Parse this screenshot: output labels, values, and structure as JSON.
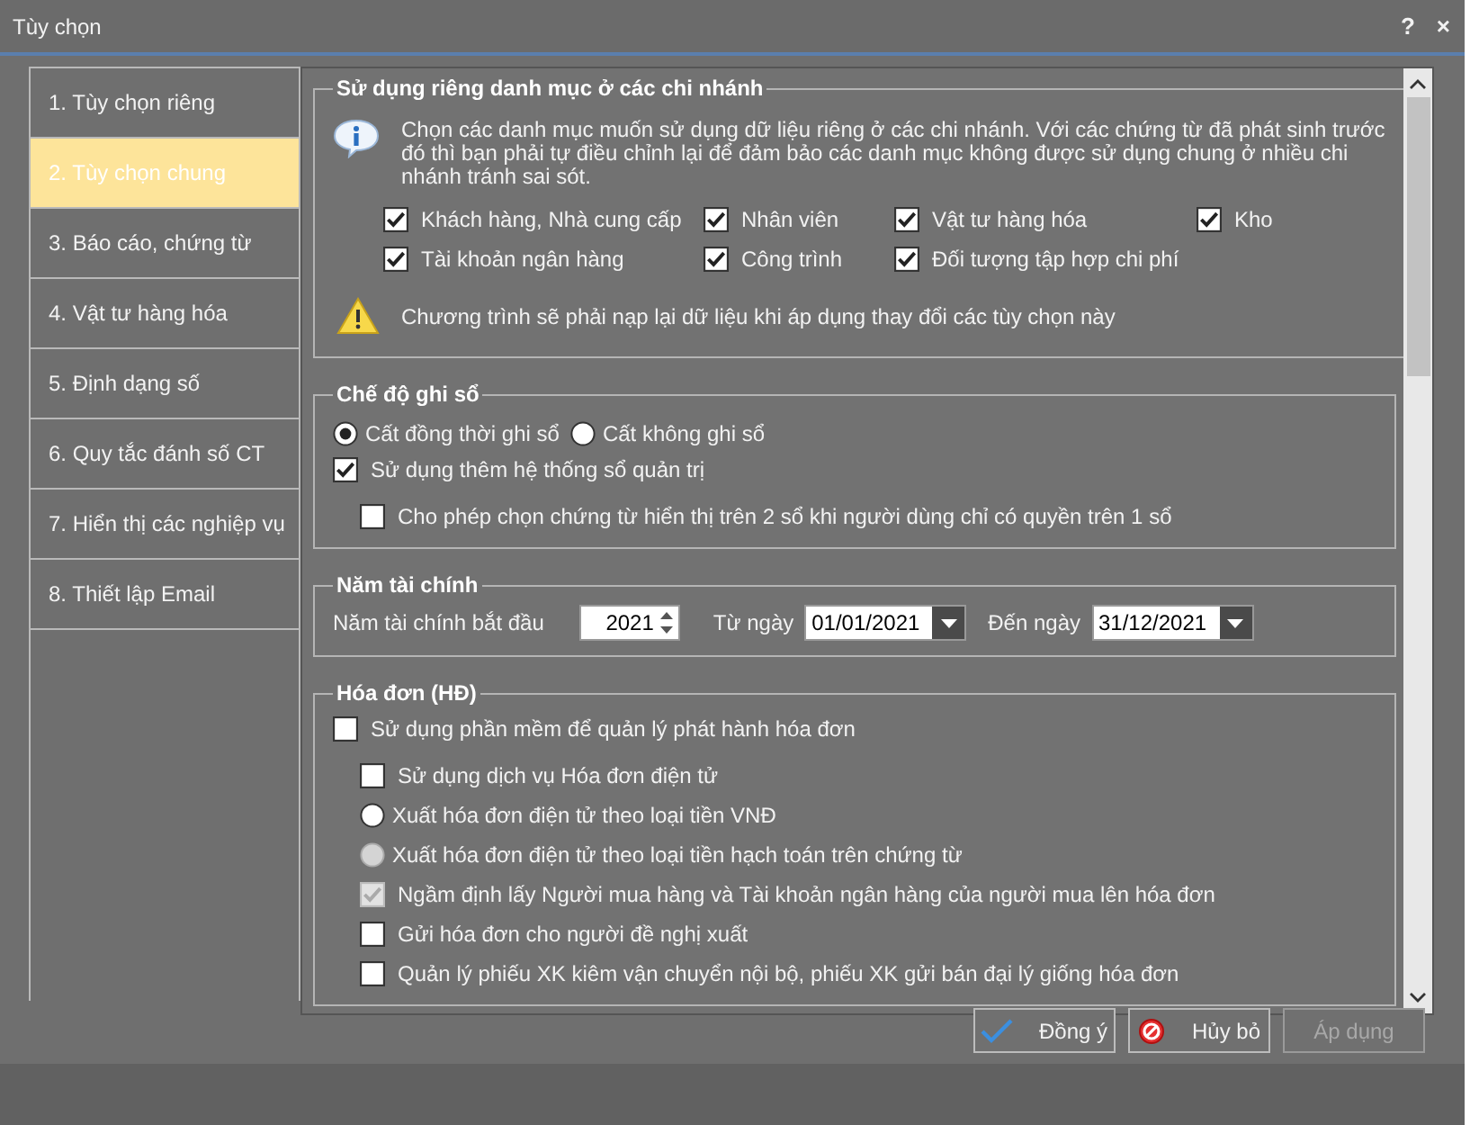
{
  "window": {
    "title": "Tùy chọn",
    "help": "?",
    "close": "×"
  },
  "sidebar": {
    "items": [
      {
        "label": "1. Tùy chọn riêng",
        "selected": false
      },
      {
        "label": "2. Tùy chọn chung",
        "selected": true
      },
      {
        "label": "3. Báo cáo, chứng từ",
        "selected": false
      },
      {
        "label": "4. Vật tư hàng hóa",
        "selected": false
      },
      {
        "label": "5. Định dạng số",
        "selected": false
      },
      {
        "label": "6. Quy tắc đánh số CT",
        "selected": false
      },
      {
        "label": "7. Hiển thị các nghiệp vụ",
        "selected": false
      },
      {
        "label": "8. Thiết lập Email",
        "selected": false
      }
    ]
  },
  "branch_section": {
    "title": "Sử dụng riêng danh mục ở các chi nhánh",
    "info": "Chọn các danh mục muốn sử dụng dữ liệu riêng ở các chi nhánh. Với các chứng từ đã phát sinh trước đó thì bạn phải tự điều chỉnh lại để đảm bảo các danh mục không được sử dụng chung ở nhiều chi nhánh tránh sai sót.",
    "options": [
      {
        "label": "Khách hàng, Nhà cung cấp",
        "checked": true
      },
      {
        "label": "Nhân viên",
        "checked": true
      },
      {
        "label": "Vật tư hàng hóa",
        "checked": true
      },
      {
        "label": "Kho",
        "checked": true
      },
      {
        "label": "Tài khoản ngân hàng",
        "checked": true
      },
      {
        "label": "Công trình",
        "checked": true
      },
      {
        "label": "Đối tượng tập hợp chi phí",
        "checked": true
      }
    ],
    "warning": "Chương trình sẽ phải nạp lại dữ liệu khi áp dụng thay đổi các tùy chọn này"
  },
  "posting_mode": {
    "title": "Chế độ ghi sổ",
    "radios": [
      {
        "label": "Cất đồng thời ghi sổ",
        "selected": true
      },
      {
        "label": "Cất không ghi sổ",
        "selected": false
      }
    ],
    "options": [
      {
        "label": "Sử dụng thêm hệ thống sổ quản trị",
        "checked": true,
        "children": [
          {
            "label": "Cho phép chọn chứng từ hiển thị trên 2 sổ khi người dùng chỉ có quyền trên 1 sổ",
            "checked": false
          }
        ]
      }
    ]
  },
  "fiscal_year": {
    "title": "Năm tài chính",
    "start_label": "Năm tài chính bắt đầu",
    "start_year": "2021",
    "from_label": "Từ ngày",
    "from_date": "01/01/2021",
    "to_label": "Đến ngày",
    "to_date": "31/12/2021"
  },
  "invoice": {
    "title": "Hóa đơn (HĐ)",
    "options": [
      {
        "kind": "checkbox",
        "label": "Sử dụng phần mềm để quản lý phát hành hóa đơn",
        "checked": false,
        "disabled": false,
        "children": [
          {
            "kind": "checkbox",
            "label": "Sử dụng dịch vụ Hóa đơn điện tử",
            "checked": false,
            "disabled": false
          },
          {
            "kind": "radio",
            "label": "Xuất hóa đơn điện tử theo loại tiền VNĐ",
            "selected": false,
            "disabled": false
          },
          {
            "kind": "radio",
            "label": "Xuất hóa đơn điện tử theo loại tiền hạch toán trên chứng từ",
            "selected": false,
            "disabled": true
          },
          {
            "kind": "checkbox",
            "label": "Ngầm định lấy Người mua hàng và Tài khoản ngân hàng của người mua lên hóa đơn",
            "checked": true,
            "disabled": true
          },
          {
            "kind": "checkbox",
            "label": "Gửi hóa đơn cho người đề nghị xuất",
            "checked": false,
            "disabled": false
          },
          {
            "kind": "checkbox",
            "label": "Quản lý phiếu XK kiêm vận chuyển nội bộ, phiếu XK gửi bán đại lý giống hóa đơn",
            "checked": false,
            "disabled": false
          }
        ]
      }
    ]
  },
  "buttons": [
    {
      "kind": "ok",
      "label": "Đồng ý",
      "disabled": false
    },
    {
      "kind": "cancel",
      "label": "Hủy bỏ",
      "disabled": false
    },
    {
      "kind": "apply",
      "label": "Áp dụng",
      "disabled": true
    }
  ]
}
